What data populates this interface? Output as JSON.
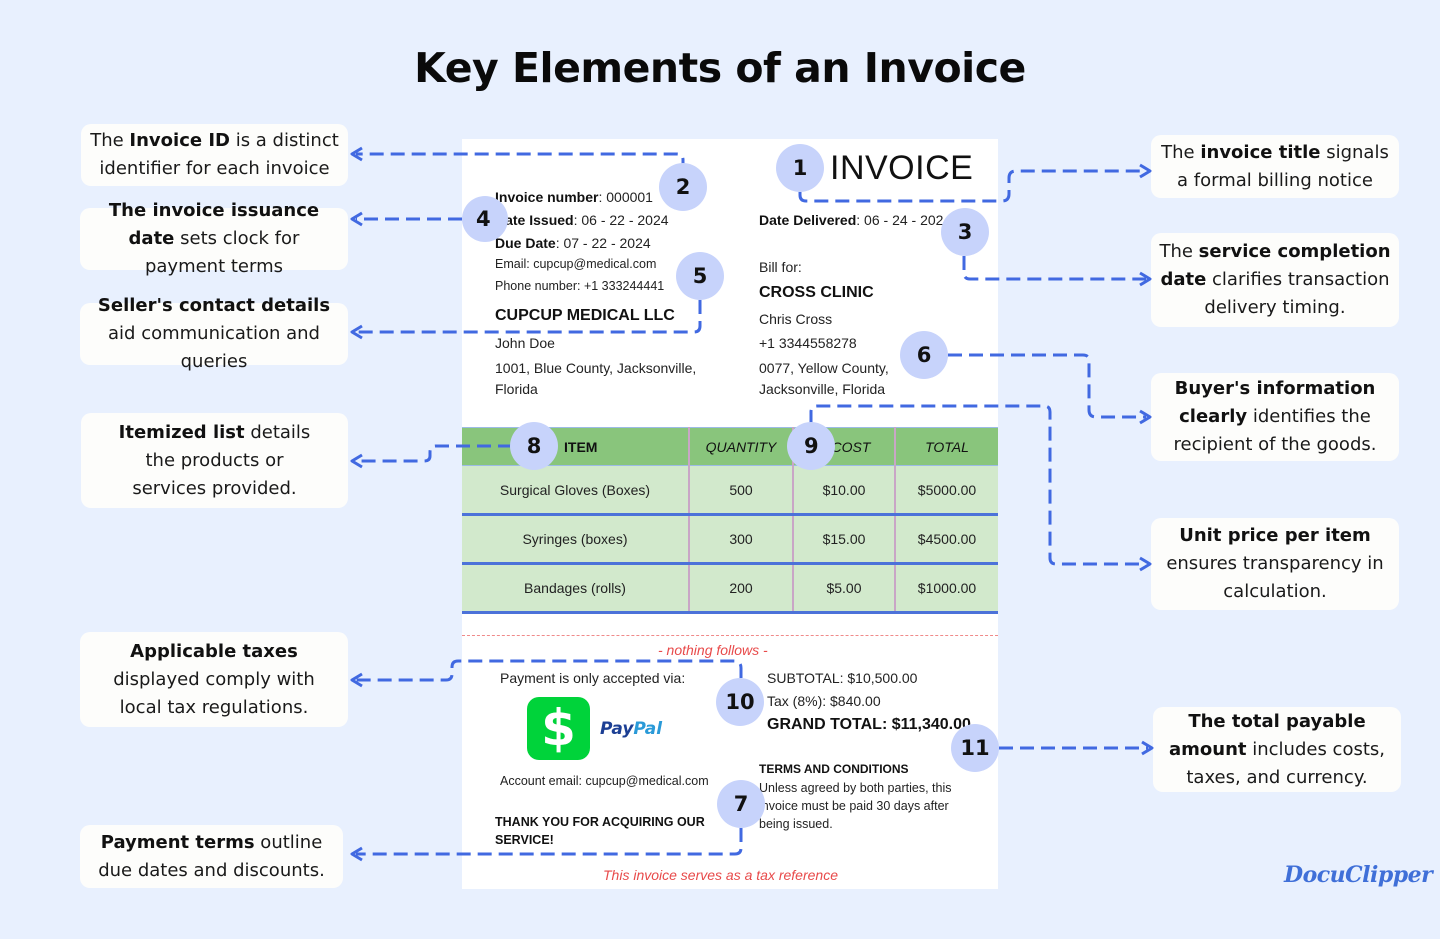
{
  "title": "Key Elements of an Invoice",
  "brand": "DocuClipper",
  "colors": {
    "background": "#e8f0fe",
    "connector": "#4169e1",
    "badge": "#c7d3fb",
    "table_header": "#89c57c",
    "table_row": "#d2e9cc",
    "note_red": "#e84a4a",
    "cashapp_green": "#00d33a"
  },
  "callouts": [
    {
      "id": 2,
      "side": "left",
      "bold": "Invoice ID",
      "pre": "The ",
      "post": " is a distinct identifier for each invoice"
    },
    {
      "id": 4,
      "side": "left",
      "bold": "The invoice issuance date",
      "pre": "",
      "post": " sets clock for payment terms"
    },
    {
      "id": 5,
      "side": "left",
      "bold": "Seller's contact details",
      "pre": "",
      "post": " aid communication and queries"
    },
    {
      "id": 8,
      "side": "left",
      "bold": "Itemized list",
      "pre": "",
      "post": " details the products or services provided."
    },
    {
      "id": 10,
      "side": "left",
      "bold": "Applicable taxes",
      "pre": "",
      "post": " displayed comply with local tax regulations."
    },
    {
      "id": 7,
      "side": "left",
      "bold": "Payment terms",
      "pre": "",
      "post": " outline due dates and discounts."
    },
    {
      "id": 1,
      "side": "right",
      "bold": "invoice title",
      "pre": "The ",
      "post": " signals a formal billing notice"
    },
    {
      "id": 3,
      "side": "right",
      "bold": "service completion date",
      "pre": "The ",
      "post": " clarifies transaction delivery timing."
    },
    {
      "id": 6,
      "side": "right",
      "bold": "Buyer's information clearly",
      "pre": "",
      "post": " identifies the recipient of the goods."
    },
    {
      "id": 9,
      "side": "right",
      "bold": "Unit price per item",
      "pre": "",
      "post": " ensures transparency in calculation."
    },
    {
      "id": 11,
      "side": "right",
      "bold": "The total payable amount",
      "pre": "",
      "post": " includes costs, taxes, and currency."
    }
  ],
  "invoice": {
    "title": "INVOICE",
    "invoice_number": {
      "label": "Invoice number",
      "value": ": 000001"
    },
    "date_issued": {
      "label": "Date Issued",
      "value": ": 06 - 22 - 2024"
    },
    "due_date": {
      "label": "Due Date",
      "value": ": 07 - 22 - 2024"
    },
    "date_delivered": {
      "label": "Date Delivered",
      "value": ": 06 - 24 - 2024"
    },
    "seller": {
      "email": "Email: cupcup@medical.com",
      "phone": "Phone number: +1 333244441",
      "company": "CUPCUP MEDICAL LLC",
      "contact": "John Doe",
      "address_line1": "1001, Blue County, Jacksonville,",
      "address_line2": "Florida"
    },
    "buyer": {
      "bill_for_label": "Bill for:",
      "company": "CROSS CLINIC",
      "contact": "Chris Cross",
      "phone": "+1 3344558278",
      "address_line1": "0077, Yellow County,",
      "address_line2": "Jacksonville, Florida"
    },
    "table": {
      "headers": [
        "ITEM",
        "QUANTITY",
        "COST",
        "TOTAL"
      ],
      "rows": [
        [
          "Surgical Gloves (Boxes)",
          "500",
          "$10.00",
          "$5000.00"
        ],
        [
          "Syringes (boxes)",
          "300",
          "$15.00",
          "$4500.00"
        ],
        [
          "Bandages (rolls)",
          "200",
          "$5.00",
          "$1000.00"
        ]
      ]
    },
    "nothing_follows": "- nothing follows -",
    "payment_label": "Payment is only accepted via:",
    "payment_methods": [
      "Cash App",
      "PayPal"
    ],
    "cashapp_glyph": "$",
    "paypal_part1": "Pay",
    "paypal_part2": "Pal",
    "account_email": "Account email: cupcup@medical.com",
    "thank_you_line1": "THANK YOU FOR ACQUIRING OUR",
    "thank_you_line2": "SERVICE!",
    "subtotal": "SUBTOTAL: $10,500.00",
    "tax": "Tax (8%): $840.00",
    "grand_total": "GRAND TOTAL: $11,340.00",
    "terms_title": "TERMS AND CONDITIONS",
    "terms_line1": "Unless agreed by both parties, this",
    "terms_line2": "invoice must be paid 30 days after",
    "terms_line3": "being issued.",
    "tax_reference": "This invoice serves as a tax reference"
  },
  "badges": [
    "1",
    "2",
    "3",
    "4",
    "5",
    "6",
    "7",
    "8",
    "9",
    "10",
    "11"
  ]
}
